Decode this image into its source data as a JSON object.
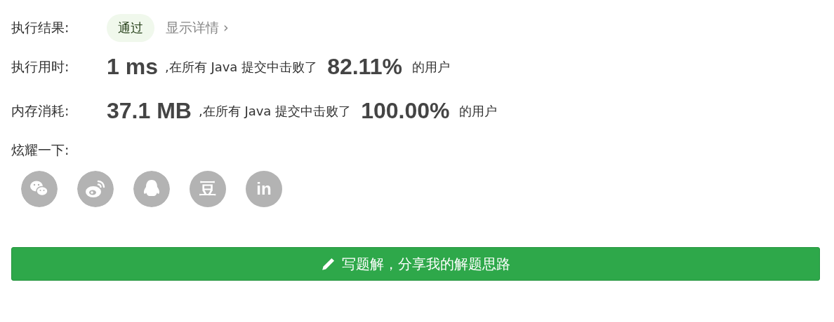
{
  "result": {
    "label": "执行结果:",
    "badge": "通过",
    "details_link": "显示详情 ›"
  },
  "stats": [
    {
      "label": "执行用时:",
      "value": "1 ms",
      "text": ",在所有 Java 提交中击败了",
      "percent": "82.11%",
      "suffix": "的用户"
    },
    {
      "label": "内存消耗:",
      "value": "37.1 MB",
      "text": ",在所有 Java 提交中击败了",
      "percent": "100.00%",
      "suffix": "的用户"
    }
  ],
  "share": {
    "label": "炫耀一下:",
    "icons": [
      {
        "kind": "chat"
      },
      {
        "kind": "weibo"
      },
      {
        "kind": "penguin"
      },
      {
        "kind": "glyph",
        "glyph": "豆"
      },
      {
        "kind": "glyph",
        "glyph": "in"
      }
    ]
  },
  "button": {
    "label": "写题解，分享我的解题思路"
  }
}
